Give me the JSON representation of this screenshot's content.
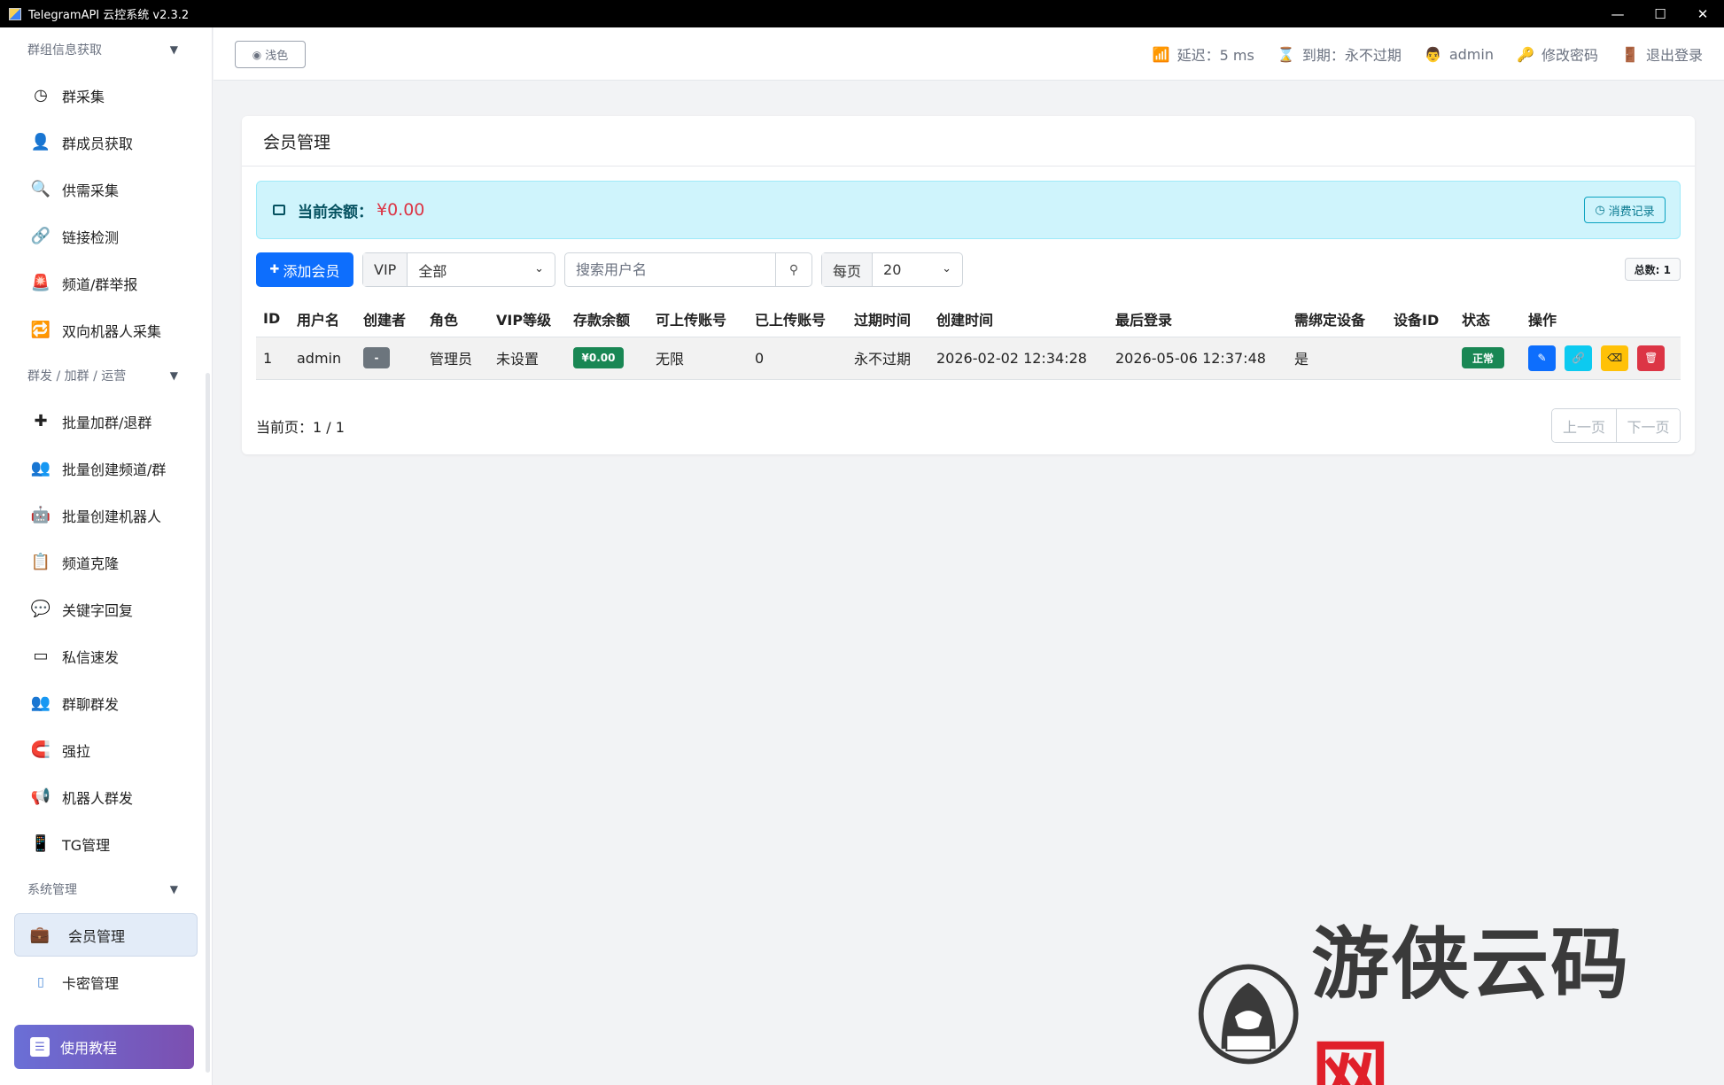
{
  "window": {
    "title": "TelegramAPI 云控系统 v2.3.2"
  },
  "sidebar": {
    "sections": [
      {
        "label": "群组信息获取",
        "items": [
          "群采集",
          "群成员获取",
          "供需采集",
          "链接检测",
          "频道/群举报",
          "双向机器人采集"
        ]
      },
      {
        "label": "群发 / 加群 / 运营",
        "items": [
          "批量加群/退群",
          "批量创建频道/群",
          "批量创建机器人",
          "频道克隆",
          "关键字回复",
          "私信速发",
          "群聊群发",
          "强拉",
          "机器人群发",
          "TG管理"
        ]
      },
      {
        "label": "系统管理",
        "items": [
          "会员管理",
          "卡密管理"
        ]
      }
    ],
    "tutorial": "使用教程",
    "active_item": "会员管理"
  },
  "header": {
    "theme_btn": "浅色",
    "latency": "延迟：5 ms",
    "expiry": "到期：永不过期",
    "user": "admin",
    "change_pwd": "修改密码",
    "logout": "退出登录"
  },
  "page": {
    "title": "会员管理",
    "balance_label": "当前余额：",
    "balance_value": "¥0.00",
    "records_btn": "消费记录",
    "add_btn": "添加会员",
    "vip_label": "VIP",
    "vip_selected": "全部",
    "search_placeholder": "搜索用户名",
    "per_page_label": "每页",
    "per_page_value": "20",
    "total": "总数: 1",
    "pager_info": "当前页：1 / 1",
    "prev": "上一页",
    "next": "下一页"
  },
  "table": {
    "headers": [
      "ID",
      "用户名",
      "创建者",
      "角色",
      "VIP等级",
      "存款余额",
      "可上传账号",
      "已上传账号",
      "过期时间",
      "创建时间",
      "最后登录",
      "需绑定设备",
      "设备ID",
      "状态",
      "操作"
    ],
    "rows": [
      {
        "id": "1",
        "username": "admin",
        "creator": "-",
        "role": "管理员",
        "vip": "未设置",
        "deposit": "¥0.00",
        "can_upload": "无限",
        "uploaded": "0",
        "expire": "永不过期",
        "created": "2026-02-02 12:34:28",
        "last_login": "2026-05-06 12:37:48",
        "bind_device": "是",
        "device_id": "",
        "status": "正常"
      }
    ]
  },
  "colors": {
    "primary": "#0d6efd",
    "success": "#198754",
    "info": "#0dcaf0",
    "warning": "#ffc107",
    "danger": "#dc3545"
  },
  "watermark": {
    "text": "游侠云码",
    "red": "网"
  }
}
